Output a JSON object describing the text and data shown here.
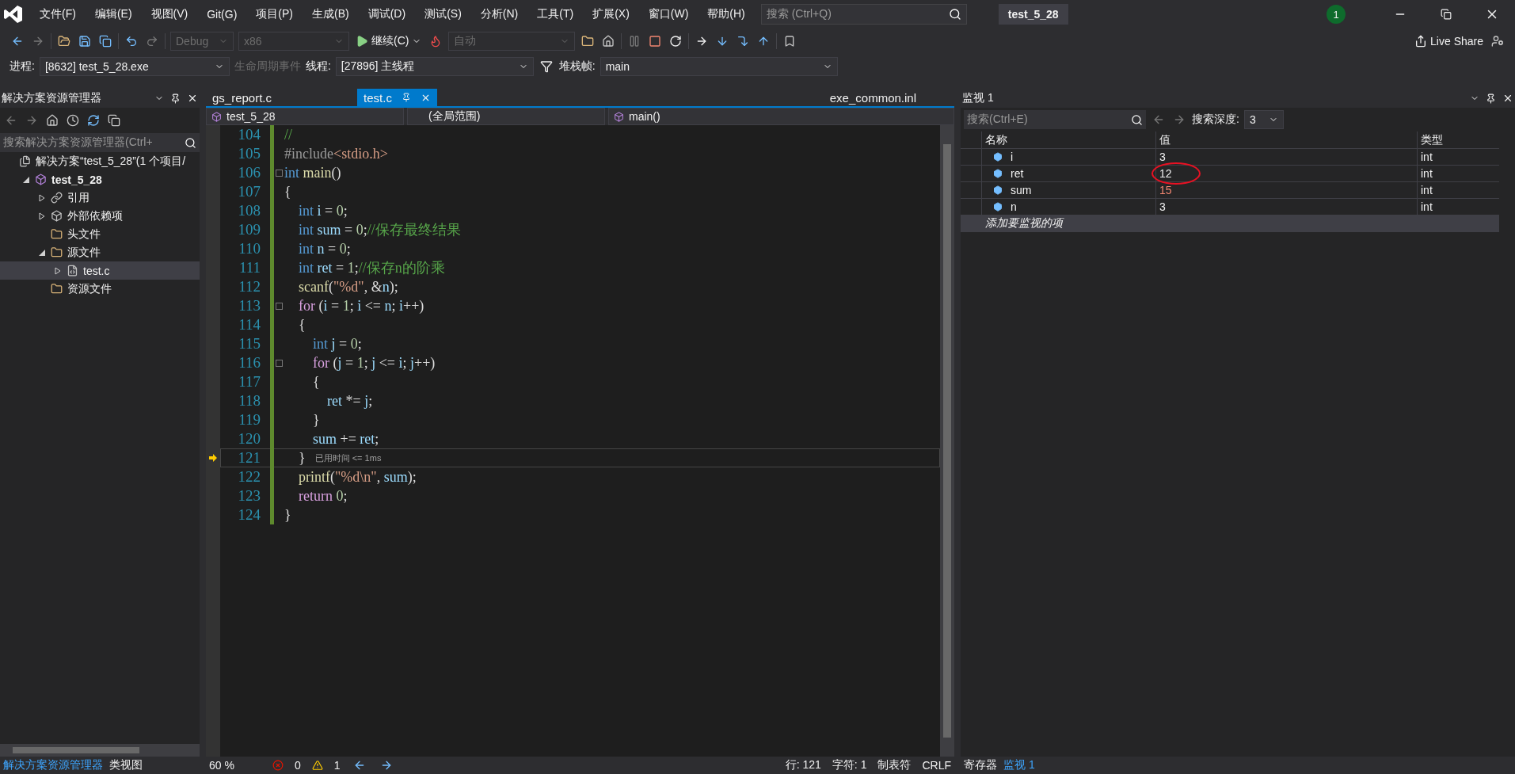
{
  "menu": [
    "文件(F)",
    "编辑(E)",
    "视图(V)",
    "Git(G)",
    "项目(P)",
    "生成(B)",
    "调试(D)",
    "测试(S)",
    "分析(N)",
    "工具(T)",
    "扩展(X)",
    "窗口(W)",
    "帮助(H)"
  ],
  "search": {
    "placeholder": "搜索 (Ctrl+Q)"
  },
  "solution_name": "test_5_28",
  "notification_count": "1",
  "toolbar": {
    "config": "Debug",
    "platform": "x86",
    "continue": "继续(C)",
    "auto": "自动",
    "live_share": "Live Share"
  },
  "debug_bar": {
    "process_label": "进程:",
    "process": "[8632] test_5_28.exe",
    "lifecycle": "生命周期事件",
    "thread_label": "线程:",
    "thread": "[27896] 主线程",
    "stack_label": "堆栈帧:",
    "stack": "main"
  },
  "solution_explorer": {
    "title": "解决方案资源管理器",
    "search_placeholder": "搜索解决方案资源管理器(Ctrl+",
    "tree": [
      {
        "label": "解决方案“test_5_28”(1 个项目/",
        "kind": "solution",
        "selected": false,
        "children": [
          {
            "label": "test_5_28",
            "kind": "project",
            "expanded": true,
            "selected": false,
            "children": [
              {
                "label": "引用",
                "kind": "references",
                "expanded": false,
                "selected": false
              },
              {
                "label": "外部依赖项",
                "kind": "external",
                "expanded": false,
                "selected": false
              },
              {
                "label": "头文件",
                "kind": "folder",
                "selected": false
              },
              {
                "label": "源文件",
                "kind": "folder",
                "expanded": true,
                "selected": false,
                "children": [
                  {
                    "label": "test.c",
                    "kind": "file",
                    "expanded": false,
                    "selected": true
                  }
                ]
              },
              {
                "label": "资源文件",
                "kind": "folder",
                "selected": false
              }
            ]
          }
        ]
      }
    ]
  },
  "editor": {
    "tabs": [
      {
        "label": "gs_report.c",
        "selected": false
      },
      {
        "label": "test.c",
        "selected": true
      }
    ],
    "preview_tab": "exe_common.inl",
    "nav": {
      "project": "test_5_28",
      "scope": "(全局范围)",
      "member": "main()"
    },
    "lines": [
      {
        "number": "104",
        "fold": false,
        "current": false,
        "tokens": [
          {
            "kind": "c",
            "text": "//"
          }
        ]
      },
      {
        "number": "105",
        "fold": false,
        "current": false,
        "tokens": [
          {
            "kind": "pre",
            "text": "#include"
          },
          {
            "kind": "s",
            "text": "<stdio.h>"
          }
        ]
      },
      {
        "number": "106",
        "fold": true,
        "current": false,
        "tokens": [
          {
            "kind": "kw",
            "text": "int"
          },
          {
            "kind": "fn",
            "text": " main"
          },
          {
            "kind": "p",
            "text": "()"
          }
        ]
      },
      {
        "number": "107",
        "fold": false,
        "current": false,
        "tokens": [
          {
            "kind": "p",
            "text": "{"
          }
        ]
      },
      {
        "number": "108",
        "fold": false,
        "current": false,
        "tokens": [
          {
            "kind": "kw",
            "text": "    int"
          },
          {
            "kind": "v",
            "text": " i "
          },
          {
            "kind": "p",
            "text": "= "
          },
          {
            "kind": "n",
            "text": "0"
          },
          {
            "kind": "p",
            "text": ";"
          }
        ]
      },
      {
        "number": "109",
        "fold": false,
        "current": false,
        "tokens": [
          {
            "kind": "kw",
            "text": "    int"
          },
          {
            "kind": "v",
            "text": " sum "
          },
          {
            "kind": "p",
            "text": "= "
          },
          {
            "kind": "n",
            "text": "0"
          },
          {
            "kind": "p",
            "text": ";"
          },
          {
            "kind": "c",
            "text": "//保存最终结果"
          }
        ]
      },
      {
        "number": "110",
        "fold": false,
        "current": false,
        "tokens": [
          {
            "kind": "kw",
            "text": "    int"
          },
          {
            "kind": "v",
            "text": " n "
          },
          {
            "kind": "p",
            "text": "= "
          },
          {
            "kind": "n",
            "text": "0"
          },
          {
            "kind": "p",
            "text": ";"
          }
        ]
      },
      {
        "number": "111",
        "fold": false,
        "current": false,
        "tokens": [
          {
            "kind": "kw",
            "text": "    int"
          },
          {
            "kind": "v",
            "text": " ret "
          },
          {
            "kind": "p",
            "text": "= "
          },
          {
            "kind": "n",
            "text": "1"
          },
          {
            "kind": "p",
            "text": ";"
          },
          {
            "kind": "c",
            "text": "//保存n的阶乘"
          }
        ]
      },
      {
        "number": "112",
        "fold": false,
        "current": false,
        "tokens": [
          {
            "kind": "fn",
            "text": "    scanf"
          },
          {
            "kind": "p",
            "text": "("
          },
          {
            "kind": "s",
            "text": "\"%d\""
          },
          {
            "kind": "p",
            "text": ", &"
          },
          {
            "kind": "v",
            "text": "n"
          },
          {
            "kind": "p",
            "text": ");"
          }
        ]
      },
      {
        "number": "113",
        "fold": true,
        "current": false,
        "tokens": [
          {
            "kind": "ctl",
            "text": "    for"
          },
          {
            "kind": "p",
            "text": " ("
          },
          {
            "kind": "v",
            "text": "i"
          },
          {
            "kind": "p",
            "text": " = "
          },
          {
            "kind": "n",
            "text": "1"
          },
          {
            "kind": "p",
            "text": "; "
          },
          {
            "kind": "v",
            "text": "i"
          },
          {
            "kind": "p",
            "text": " <= "
          },
          {
            "kind": "v",
            "text": "n"
          },
          {
            "kind": "p",
            "text": "; "
          },
          {
            "kind": "v",
            "text": "i"
          },
          {
            "kind": "p",
            "text": "++)"
          }
        ]
      },
      {
        "number": "114",
        "fold": false,
        "current": false,
        "tokens": [
          {
            "kind": "p",
            "text": "    {"
          }
        ]
      },
      {
        "number": "115",
        "fold": false,
        "current": false,
        "tokens": [
          {
            "kind": "kw",
            "text": "        int"
          },
          {
            "kind": "v",
            "text": " j "
          },
          {
            "kind": "p",
            "text": "= "
          },
          {
            "kind": "n",
            "text": "0"
          },
          {
            "kind": "p",
            "text": ";"
          }
        ]
      },
      {
        "number": "116",
        "fold": true,
        "current": false,
        "tokens": [
          {
            "kind": "ctl",
            "text": "        for"
          },
          {
            "kind": "p",
            "text": " ("
          },
          {
            "kind": "v",
            "text": "j"
          },
          {
            "kind": "p",
            "text": " = "
          },
          {
            "kind": "n",
            "text": "1"
          },
          {
            "kind": "p",
            "text": "; "
          },
          {
            "kind": "v",
            "text": "j"
          },
          {
            "kind": "p",
            "text": " <= "
          },
          {
            "kind": "v",
            "text": "i"
          },
          {
            "kind": "p",
            "text": "; "
          },
          {
            "kind": "v",
            "text": "j"
          },
          {
            "kind": "p",
            "text": "++)"
          }
        ]
      },
      {
        "number": "117",
        "fold": false,
        "current": false,
        "tokens": [
          {
            "kind": "p",
            "text": "        {"
          }
        ]
      },
      {
        "number": "118",
        "fold": false,
        "current": false,
        "tokens": [
          {
            "kind": "v",
            "text": "            ret"
          },
          {
            "kind": "p",
            "text": " *= "
          },
          {
            "kind": "v",
            "text": "j"
          },
          {
            "kind": "p",
            "text": ";"
          }
        ]
      },
      {
        "number": "119",
        "fold": false,
        "current": false,
        "tokens": [
          {
            "kind": "p",
            "text": "        }"
          }
        ]
      },
      {
        "number": "120",
        "fold": false,
        "current": false,
        "tokens": [
          {
            "kind": "v",
            "text": "        sum"
          },
          {
            "kind": "p",
            "text": " += "
          },
          {
            "kind": "v",
            "text": "ret"
          },
          {
            "kind": "p",
            "text": ";"
          }
        ]
      },
      {
        "number": "121",
        "fold": false,
        "current": true,
        "hint": "已用时间 <= 1ms",
        "tokens": [
          {
            "kind": "p",
            "text": "    }"
          }
        ]
      },
      {
        "number": "122",
        "fold": false,
        "current": false,
        "tokens": [
          {
            "kind": "fn",
            "text": "    printf"
          },
          {
            "kind": "p",
            "text": "("
          },
          {
            "kind": "s",
            "text": "\"%d\\n\""
          },
          {
            "kind": "p",
            "text": ", "
          },
          {
            "kind": "v",
            "text": "sum"
          },
          {
            "kind": "p",
            "text": ");"
          }
        ]
      },
      {
        "number": "123",
        "fold": false,
        "current": false,
        "tokens": [
          {
            "kind": "ctl",
            "text": "    return"
          },
          {
            "kind": "n",
            "text": " 0"
          },
          {
            "kind": "p",
            "text": ";"
          }
        ]
      },
      {
        "number": "124",
        "fold": false,
        "current": false,
        "tokens": [
          {
            "kind": "p",
            "text": "}"
          }
        ]
      }
    ],
    "zoom": "60 %",
    "errors": "0",
    "warnings": "1",
    "line": "行: 121",
    "col": "字符: 1",
    "indent_mode": "制表符",
    "eol": "CRLF"
  },
  "watch": {
    "title": "监视 1",
    "search_placeholder": "搜索(Ctrl+E)",
    "depth_label": "搜索深度:",
    "depth": "3",
    "columns": [
      "名称",
      "值",
      "类型"
    ],
    "rows": [
      {
        "name": "i",
        "value": "3",
        "type": "int",
        "changed": false,
        "circled": false
      },
      {
        "name": "ret",
        "value": "12",
        "type": "int",
        "changed": false,
        "circled": true
      },
      {
        "name": "sum",
        "value": "15",
        "type": "int",
        "changed": true,
        "circled": false
      },
      {
        "name": "n",
        "value": "3",
        "type": "int",
        "changed": false,
        "circled": false
      }
    ],
    "add_placeholder": "添加要监视的项"
  },
  "left_tabs": [
    {
      "label": "解决方案资源管理器",
      "selected": true
    },
    {
      "label": "类视图",
      "selected": false
    }
  ],
  "right_tabs": [
    {
      "label": "寄存器",
      "selected": false
    },
    {
      "label": "监视 1",
      "selected": true
    }
  ]
}
